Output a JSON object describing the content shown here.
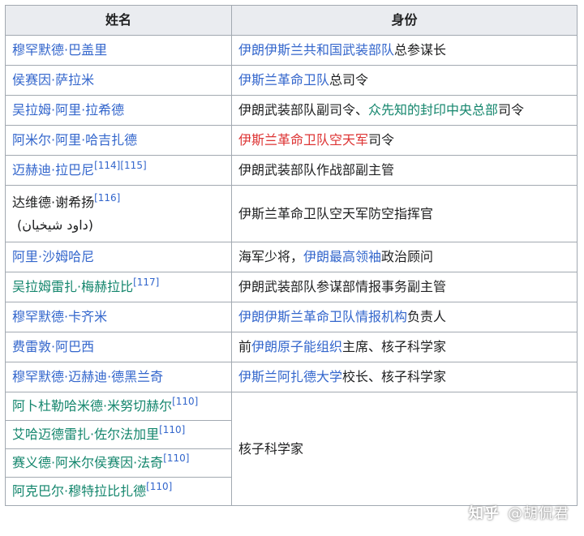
{
  "header": {
    "name": "姓名",
    "identity": "身份"
  },
  "rows": [
    {
      "name": "穆罕默德·巴盖里",
      "ident_link": "伊朗伊斯兰共和国武装部队",
      "ident_rest": "总参谋长"
    },
    {
      "name": "侯赛因·萨拉米",
      "ident_link": "伊斯兰革命卫队",
      "ident_rest": "总司令"
    },
    {
      "name": "吴拉姆·阿里·拉希德",
      "ident_pre": "伊朗武装部队副司令、",
      "ident_link": "众先知的封印中央总部",
      "ident_rest": "司令"
    },
    {
      "name": "阿米尔·阿里·哈吉扎德",
      "ident_link": "伊斯兰革命卫队空天军",
      "ident_rest": "司令"
    },
    {
      "name": "迈赫迪·拉巴尼",
      "name_sup": "[114][115]",
      "ident_text": "伊朗武装部队作战部副主管"
    },
    {
      "name": "达维德·谢希扬",
      "name_sup": "[116]",
      "name_native": "(داود شیخیان)",
      "ident_text": "伊斯兰革命卫队空天军防空指挥官"
    },
    {
      "name": "阿里·沙姆哈尼",
      "ident_pre": "海军少将，",
      "ident_link": "伊朗最高领袖",
      "ident_rest": "政治顾问"
    },
    {
      "name": "吴拉姆雷扎·梅赫拉比",
      "name_sup": "[117]",
      "ident_text": "伊朗武装部队参谋部情报事务副主管"
    },
    {
      "name": "穆罕默德·卡齐米",
      "ident_link": "伊朗伊斯兰革命卫队情报机构",
      "ident_rest": "负责人"
    },
    {
      "name": "费雷敦·阿巴西",
      "ident_pre": "前",
      "ident_link": "伊朗原子能组织",
      "ident_rest": "主席、核子科学家"
    },
    {
      "name": "穆罕默德·迈赫迪·德黑兰奇",
      "ident_link": "伊斯兰阿扎德大学",
      "ident_rest": "校长、核子科学家"
    }
  ],
  "group": {
    "ident_text": "核子科学家",
    "names": [
      {
        "name": "阿卜杜勒哈米德·米努切赫尔",
        "sup": "[110]"
      },
      {
        "name": "艾哈迈德雷扎·佐尔法加里",
        "sup": "[110]"
      },
      {
        "name": "赛义德·阿米尔侯赛因·法奇",
        "sup": "[110]"
      },
      {
        "name": "阿克巴尔·穆特拉比扎德",
        "sup": "[110]"
      }
    ]
  },
  "watermark": {
    "logo": "知乎",
    "author": "@胡侃君"
  },
  "colors": {
    "link": "#3366cc",
    "visited_green": "#14866d",
    "redlink": "#dd3333",
    "header_bg": "#eaecf0",
    "border": "#a2a9b1"
  }
}
